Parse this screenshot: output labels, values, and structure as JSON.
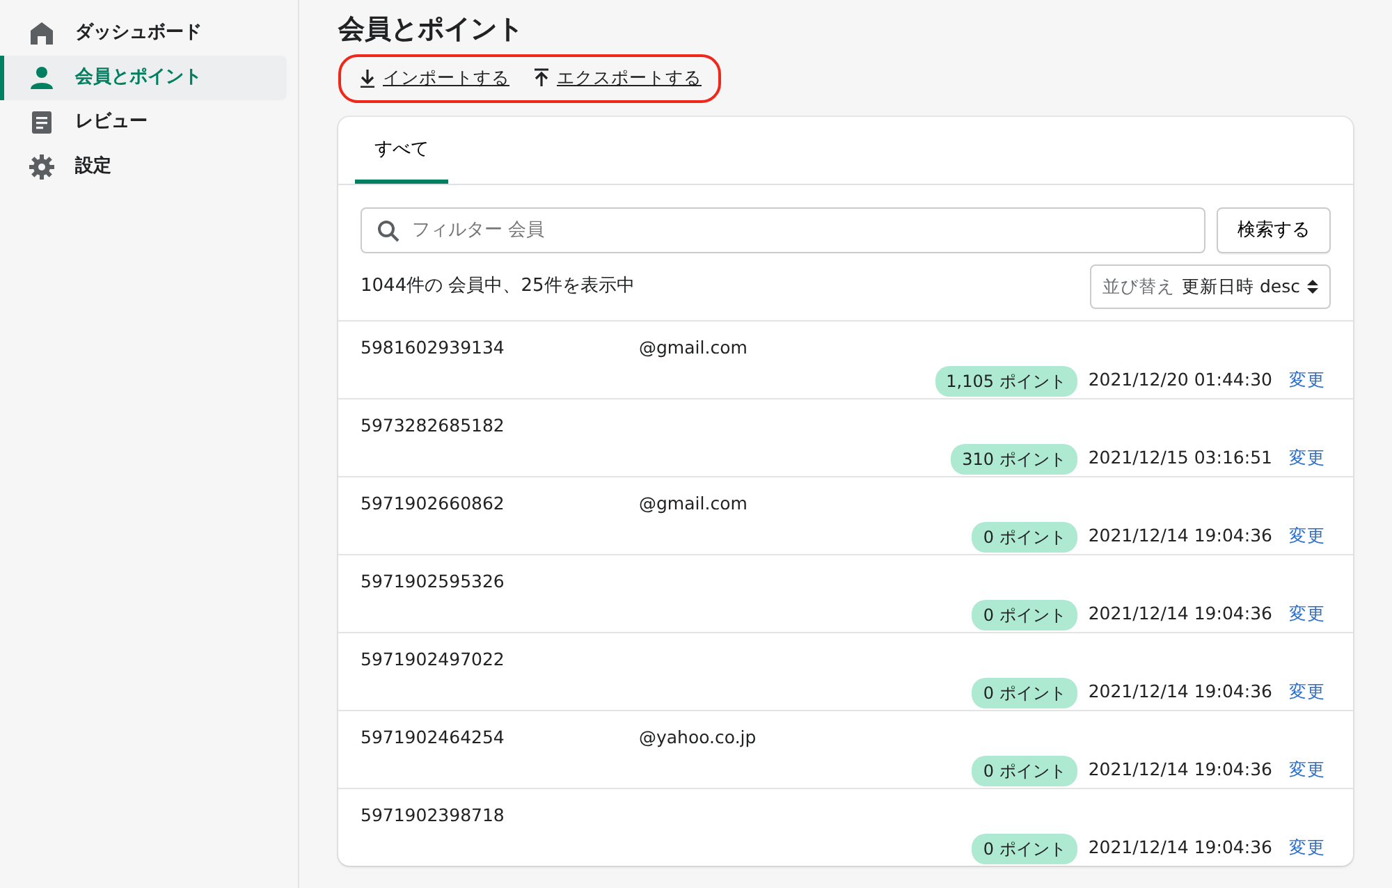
{
  "sidebar": {
    "items": [
      {
        "label": "ダッシュボード",
        "selected": false
      },
      {
        "label": "会員とポイント",
        "selected": true
      },
      {
        "label": "レビュー",
        "selected": false
      },
      {
        "label": "設定",
        "selected": false
      }
    ]
  },
  "page_title": "会員とポイント",
  "actions": [
    {
      "label": "インポートする"
    },
    {
      "label": "エクスポートする"
    }
  ],
  "actions_highlighted": true,
  "tabs": [
    {
      "label": "すべて",
      "selected": true
    }
  ],
  "search": {
    "placeholder": "フィルター 会員",
    "button": "検索する"
  },
  "summary": "1044件の 会員中、25件を表示中",
  "sort": {
    "label": "並び替え",
    "value": "更新日時 desc"
  },
  "rows": [
    {
      "id": "5981602939134",
      "email": "@gmail.com",
      "points": "1,105 ポイント",
      "updated": "2021/12/20 01:44:30",
      "action": "変更"
    },
    {
      "id": "5973282685182",
      "points": "310 ポイント",
      "updated": "2021/12/15 03:16:51",
      "action": "変更"
    },
    {
      "id": "5971902660862",
      "email": "@gmail.com",
      "points": "0 ポイント",
      "updated": "2021/12/14 19:04:36",
      "action": "変更"
    },
    {
      "id": "5971902595326",
      "points": "0 ポイント",
      "updated": "2021/12/14 19:04:36",
      "action": "変更"
    },
    {
      "id": "5971902497022",
      "points": "0 ポイント",
      "updated": "2021/12/14 19:04:36",
      "action": "変更"
    },
    {
      "id": "5971902464254",
      "email": "@yahoo.co.jp",
      "points": "0 ポイント",
      "updated": "2021/12/14 19:04:36",
      "action": "変更"
    },
    {
      "id": "5971902398718",
      "points": "0 ポイント",
      "updated": "2021/12/14 19:04:36",
      "action": "変更"
    }
  ]
}
